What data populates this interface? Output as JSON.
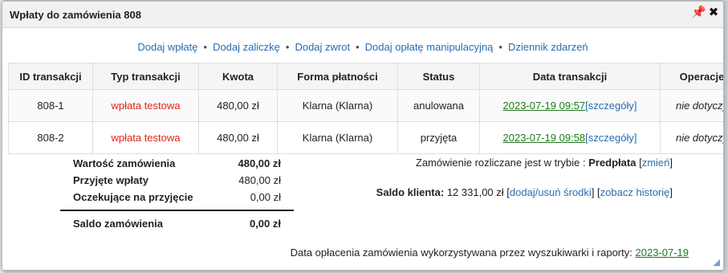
{
  "dialog": {
    "title": "Wpłaty do zamówienia 808"
  },
  "actions": [
    "Dodaj wpłatę",
    "Dodaj zaliczkę",
    "Dodaj zwrot",
    "Dodaj opłatę manipulacyjną",
    "Dziennik zdarzeń"
  ],
  "table": {
    "headers": [
      "ID transakcji",
      "Typ transakcji",
      "Kwota",
      "Forma płatności",
      "Status",
      "Data transakcji",
      "Operacje"
    ],
    "rows": [
      {
        "id": "808-1",
        "type": "wpłata testowa",
        "amount": "480,00 zł",
        "method": "Klarna (Klarna)",
        "status": "anulowana",
        "date": "2023-07-19 09:57",
        "details": "[szczegóły]",
        "ops": "nie dotyczy"
      },
      {
        "id": "808-2",
        "type": "wpłata testowa",
        "amount": "480,00 zł",
        "method": "Klarna (Klarna)",
        "status": "przyjęta",
        "date": "2023-07-19 09:58",
        "details": "[szczegóły]",
        "ops": "nie dotyczy"
      }
    ]
  },
  "summary": {
    "order_value_label": "Wartość zamówienia",
    "order_value": "480,00 zł",
    "accepted_label": "Przyjęte wpłaty",
    "accepted": "480,00 zł",
    "pending_label": "Oczekujące na przyjęcie",
    "pending": "0,00 zł",
    "balance_label": "Saldo zamówienia",
    "balance": "0,00 zł"
  },
  "settlement": {
    "text": "Zamówienie rozliczane jest w trybie : ",
    "mode": "Predpłata",
    "change": "zmień"
  },
  "client_balance": {
    "label": "Saldo klienta:",
    "value": "12 331,00 zł",
    "add_remove": "dodaj/usuń środki",
    "history": "zobacz historię"
  },
  "footer": {
    "text": "Data opłacenia zamówienia wykorzystywana przez wyszukiwarki i raporty:",
    "date": "2023-07-19"
  }
}
